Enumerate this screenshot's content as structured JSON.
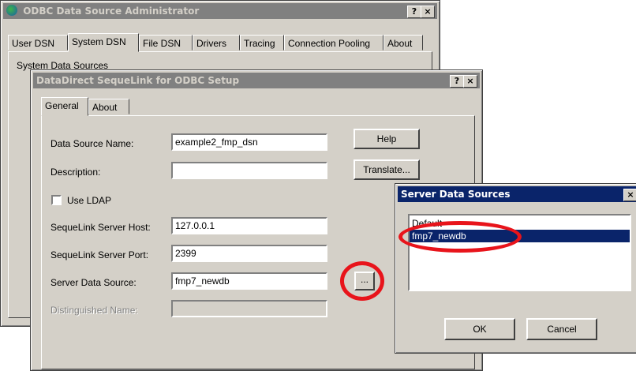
{
  "odbc_admin": {
    "title": "ODBC Data Source Administrator",
    "help_btn": "?",
    "close_btn": "×",
    "tabs": [
      "User DSN",
      "System DSN",
      "File DSN",
      "Drivers",
      "Tracing",
      "Connection Pooling",
      "About"
    ],
    "section_label": "System Data Sources"
  },
  "setup": {
    "title": "DataDirect SequeLink for ODBC Setup",
    "help_btn": "?",
    "close_btn": "×",
    "tabs": [
      "General",
      "About"
    ],
    "labels": {
      "dsn_name": "Data Source Name:",
      "description": "Description:",
      "use_ldap": "Use LDAP",
      "server_host": "SequeLink Server Host:",
      "server_port": "SequeLink Server Port:",
      "server_data_source": "Server Data Source:",
      "distinguished_name": "Distinguished Name:"
    },
    "values": {
      "dsn_name": "example2_fmp_dsn",
      "description": "",
      "server_host": "127.0.0.1",
      "server_port": "2399",
      "server_data_source": "fmp7_newdb",
      "distinguished_name": ""
    },
    "use_ldap_checked": false,
    "buttons": {
      "help": "Help",
      "translate": "Translate...",
      "browse": "..."
    }
  },
  "server_sources": {
    "title": "Server Data Sources",
    "close_btn": "×",
    "items": [
      {
        "label": "Default"
      },
      {
        "label": "fmp7_newdb"
      }
    ],
    "selected_index": 1,
    "buttons": {
      "ok": "OK",
      "cancel": "Cancel"
    }
  },
  "highlight_color": "#e8141b"
}
